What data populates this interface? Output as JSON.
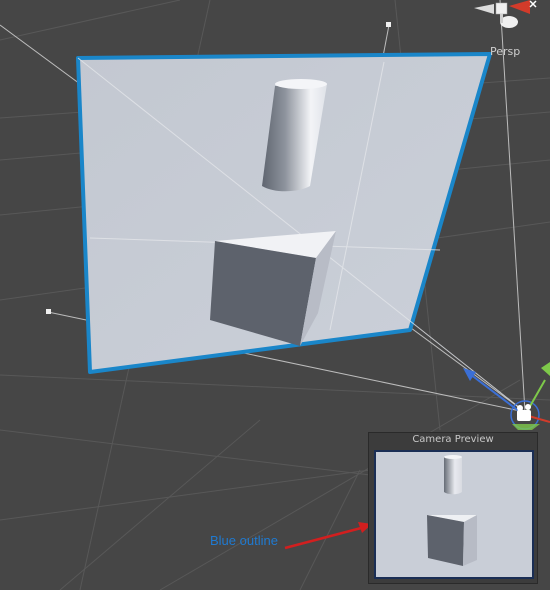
{
  "viewport": {
    "projection_label": "Persp",
    "background_color": "#464646",
    "plane_fill_color": "#c7ccd5",
    "plane_outline_color": "#1a86c9"
  },
  "gizmo": {
    "x_axis_color": "#d23b2a",
    "y_axis_color": "#7ec94a",
    "z_axis_color": "#3b6fd6"
  },
  "camera_preview": {
    "title": "Camera Preview",
    "frame_border_color": "#1a2e55"
  },
  "annotation": {
    "label": "Blue outline",
    "label_color": "#1f7ad1",
    "arrow_color": "#d21f1f"
  },
  "icons": [
    "scene-orientation-gizmo",
    "camera-icon",
    "move-arrow-icon"
  ]
}
